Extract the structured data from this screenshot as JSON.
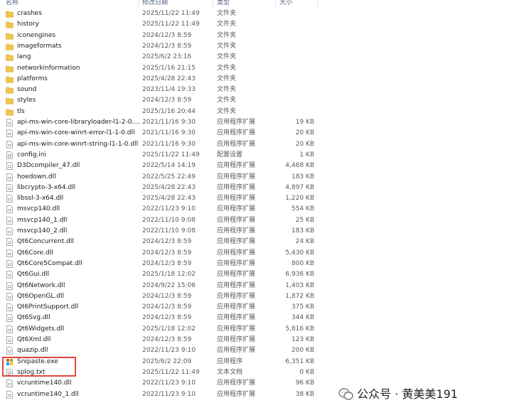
{
  "header": {
    "name": "名称",
    "date": "修改日期",
    "type": "类型",
    "size": "大小"
  },
  "files": [
    {
      "name": "crashes",
      "date": "2025/11/22 11:49",
      "type": "文件夹",
      "size": "",
      "kind": "folder"
    },
    {
      "name": "history",
      "date": "2025/11/22 11:49",
      "type": "文件夹",
      "size": "",
      "kind": "folder"
    },
    {
      "name": "iconengines",
      "date": "2024/12/3 8:59",
      "type": "文件夹",
      "size": "",
      "kind": "folder"
    },
    {
      "name": "imageformats",
      "date": "2024/12/3 8:59",
      "type": "文件夹",
      "size": "",
      "kind": "folder"
    },
    {
      "name": "lang",
      "date": "2025/6/2 23:16",
      "type": "文件夹",
      "size": "",
      "kind": "folder"
    },
    {
      "name": "networkinformation",
      "date": "2025/1/16 21:15",
      "type": "文件夹",
      "size": "",
      "kind": "folder"
    },
    {
      "name": "platforms",
      "date": "2025/4/28 22:43",
      "type": "文件夹",
      "size": "",
      "kind": "folder"
    },
    {
      "name": "sound",
      "date": "2023/11/4 19:33",
      "type": "文件夹",
      "size": "",
      "kind": "folder"
    },
    {
      "name": "styles",
      "date": "2024/12/3 8:59",
      "type": "文件夹",
      "size": "",
      "kind": "folder"
    },
    {
      "name": "tls",
      "date": "2025/1/16 20:44",
      "type": "文件夹",
      "size": "",
      "kind": "folder"
    },
    {
      "name": "api-ms-win-core-libraryloader-l1-2-0....",
      "date": "2021/11/16 9:30",
      "type": "应用程序扩展",
      "size": "19 KB",
      "kind": "dll"
    },
    {
      "name": "api-ms-win-core-winrt-error-l1-1-0.dll",
      "date": "2021/11/16 9:30",
      "type": "应用程序扩展",
      "size": "20 KB",
      "kind": "dll"
    },
    {
      "name": "api-ms-win-core-winrt-string-l1-1-0.dll",
      "date": "2021/11/16 9:30",
      "type": "应用程序扩展",
      "size": "20 KB",
      "kind": "dll"
    },
    {
      "name": "config.ini",
      "date": "2025/11/22 11:49",
      "type": "配置设置",
      "size": "1 KB",
      "kind": "ini"
    },
    {
      "name": "D3Dcompiler_47.dll",
      "date": "2022/5/14 14:19",
      "type": "应用程序扩展",
      "size": "4,468 KB",
      "kind": "dll"
    },
    {
      "name": "hoedown.dll",
      "date": "2022/5/25 22:49",
      "type": "应用程序扩展",
      "size": "183 KB",
      "kind": "dll"
    },
    {
      "name": "libcrypto-3-x64.dll",
      "date": "2025/4/28 22:43",
      "type": "应用程序扩展",
      "size": "4,897 KB",
      "kind": "dll"
    },
    {
      "name": "libssl-3-x64.dll",
      "date": "2025/4/28 22:43",
      "type": "应用程序扩展",
      "size": "1,220 KB",
      "kind": "dll"
    },
    {
      "name": "msvcp140.dll",
      "date": "2022/11/23 9:10",
      "type": "应用程序扩展",
      "size": "554 KB",
      "kind": "dll"
    },
    {
      "name": "msvcp140_1.dll",
      "date": "2022/11/10 9:08",
      "type": "应用程序扩展",
      "size": "25 KB",
      "kind": "dll"
    },
    {
      "name": "msvcp140_2.dll",
      "date": "2022/11/10 9:08",
      "type": "应用程序扩展",
      "size": "183 KB",
      "kind": "dll"
    },
    {
      "name": "Qt6Concurrent.dll",
      "date": "2024/12/3 8:59",
      "type": "应用程序扩展",
      "size": "24 KB",
      "kind": "dll"
    },
    {
      "name": "Qt6Core.dll",
      "date": "2024/12/3 8:59",
      "type": "应用程序扩展",
      "size": "5,430 KB",
      "kind": "dll"
    },
    {
      "name": "Qt6Core5Compat.dll",
      "date": "2024/12/3 8:59",
      "type": "应用程序扩展",
      "size": "800 KB",
      "kind": "dll"
    },
    {
      "name": "Qt6Gui.dll",
      "date": "2025/1/18 12:02",
      "type": "应用程序扩展",
      "size": "6,936 KB",
      "kind": "dll"
    },
    {
      "name": "Qt6Network.dll",
      "date": "2024/9/22 15:06",
      "type": "应用程序扩展",
      "size": "1,403 KB",
      "kind": "dll"
    },
    {
      "name": "Qt6OpenGL.dll",
      "date": "2024/12/3 8:59",
      "type": "应用程序扩展",
      "size": "1,872 KB",
      "kind": "dll"
    },
    {
      "name": "Qt6PrintSupport.dll",
      "date": "2024/12/3 8:59",
      "type": "应用程序扩展",
      "size": "375 KB",
      "kind": "dll"
    },
    {
      "name": "Qt6Svg.dll",
      "date": "2024/12/3 8:59",
      "type": "应用程序扩展",
      "size": "344 KB",
      "kind": "dll"
    },
    {
      "name": "Qt6Widgets.dll",
      "date": "2025/1/18 12:02",
      "type": "应用程序扩展",
      "size": "5,816 KB",
      "kind": "dll"
    },
    {
      "name": "Qt6Xml.dll",
      "date": "2024/12/3 8:59",
      "type": "应用程序扩展",
      "size": "123 KB",
      "kind": "dll"
    },
    {
      "name": "quazip.dll",
      "date": "2022/11/23 9:10",
      "type": "应用程序扩展",
      "size": "200 KB",
      "kind": "dll"
    },
    {
      "name": "Snipaste.exe",
      "date": "2025/6/2 22:09",
      "type": "应用程序",
      "size": "6,351 KB",
      "kind": "exe"
    },
    {
      "name": "splog.txt",
      "date": "2025/11/22 11:49",
      "type": "文本文档",
      "size": "0 KB",
      "kind": "txt"
    },
    {
      "name": "vcruntime140.dll",
      "date": "2022/11/23 9:10",
      "type": "应用程序扩展",
      "size": "96 KB",
      "kind": "dll"
    },
    {
      "name": "vcruntime140_1.dll",
      "date": "2022/11/23 9:10",
      "type": "应用程序扩展",
      "size": "38 KB",
      "kind": "dll"
    }
  ],
  "watermark": {
    "text": "公众号 · 黄美美191"
  },
  "colors": {
    "folder": "#f2c450",
    "highlight": "#e0463c",
    "header_text": "#4d6180"
  }
}
